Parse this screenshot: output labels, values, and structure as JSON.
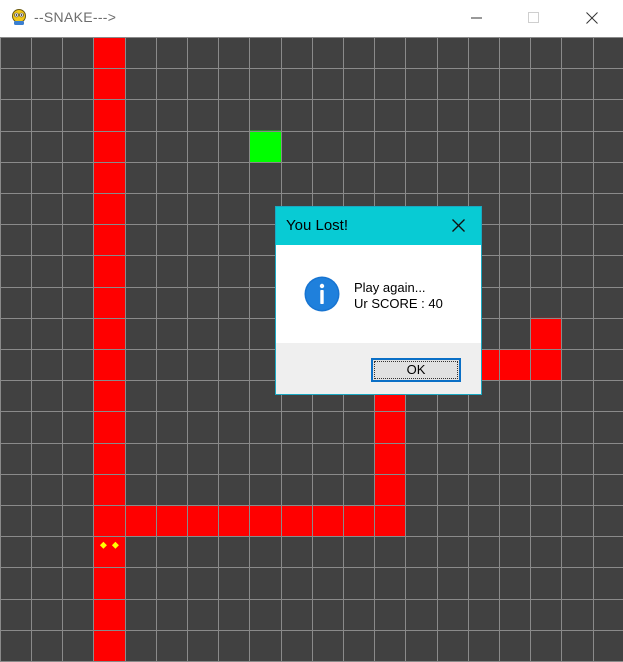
{
  "window": {
    "title": "--SNAKE--->",
    "app_icon": "pygame-snake-icon",
    "controls": [
      "minimize-icon",
      "maximize-icon",
      "close-icon"
    ]
  },
  "game": {
    "background_color": "#414141",
    "grid_line_color": "#8a8a8a",
    "snake_color": "#ff0000",
    "food_color": "#00ff00",
    "eye_color": "#ffff00",
    "snake_segments": [
      [
        3,
        0
      ],
      [
        3,
        1
      ],
      [
        3,
        2
      ],
      [
        3,
        3
      ],
      [
        3,
        4
      ],
      [
        3,
        5
      ],
      [
        3,
        6
      ],
      [
        3,
        7
      ],
      [
        3,
        8
      ],
      [
        3,
        9
      ],
      [
        3,
        10
      ],
      [
        3,
        11
      ],
      [
        3,
        12
      ],
      [
        3,
        13
      ],
      [
        3,
        14
      ],
      [
        3,
        15
      ],
      [
        4,
        15
      ],
      [
        5,
        15
      ],
      [
        6,
        15
      ],
      [
        7,
        15
      ],
      [
        8,
        15
      ],
      [
        9,
        15
      ],
      [
        10,
        15
      ],
      [
        11,
        15
      ],
      [
        12,
        15
      ],
      [
        12,
        14
      ],
      [
        12,
        13
      ],
      [
        12,
        12
      ],
      [
        12,
        11
      ],
      [
        12,
        10
      ],
      [
        13,
        10
      ],
      [
        14,
        10
      ],
      [
        15,
        10
      ],
      [
        16,
        10
      ],
      [
        17,
        10
      ],
      [
        17,
        9
      ],
      [
        3,
        16
      ],
      [
        3,
        17
      ],
      [
        3,
        18
      ],
      [
        3,
        19
      ]
    ],
    "snake_head": [
      3,
      16
    ],
    "food": [
      8,
      3
    ]
  },
  "dialog": {
    "title": "You Lost!",
    "icon": "info-icon",
    "message_line1": "Play again...",
    "message_line2": "Ur SCORE : 40",
    "ok_label": "OK",
    "header_color": "#08cbd4"
  }
}
